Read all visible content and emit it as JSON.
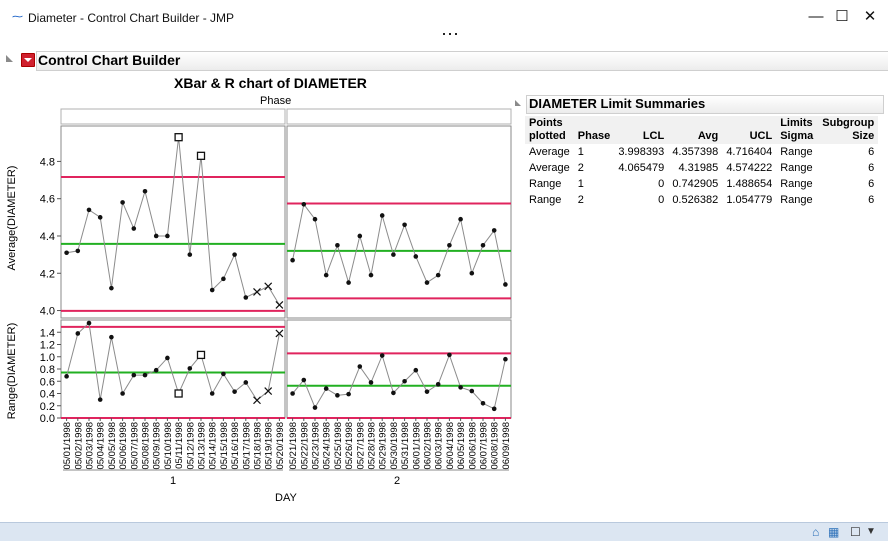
{
  "window": {
    "title": "Diameter - Control Chart Builder - JMP",
    "app_icon": "jmp-icon",
    "minimize": "—",
    "maximize": "☐",
    "close": "✕"
  },
  "report": {
    "header": "Control Chart Builder",
    "chart_title": "XBar & R chart of DIAMETER",
    "phase_label": "Phase",
    "phase_headers": [
      "1",
      "2"
    ],
    "xbar_ylabel": "Average(DIAMETER)",
    "r_ylabel": "Range(DIAMETER)",
    "x_group_labels": [
      "1",
      "2"
    ],
    "xlabel": "DAY"
  },
  "summary": {
    "title": "DIAMETER Limit Summaries",
    "columns": [
      "Points plotted",
      "Phase",
      "LCL",
      "Avg",
      "UCL",
      "Limits Sigma",
      "Subgroup Size"
    ],
    "rows": [
      [
        "Average",
        "1",
        "3.998393",
        "4.357398",
        "4.716404",
        "Range",
        "6"
      ],
      [
        "Average",
        "2",
        "4.065479",
        "4.31985",
        "4.574222",
        "Range",
        "6"
      ],
      [
        "Range",
        "1",
        "0",
        "0.742905",
        "1.488654",
        "Range",
        "6"
      ],
      [
        "Range",
        "2",
        "0",
        "0.526382",
        "1.054779",
        "Range",
        "6"
      ]
    ]
  },
  "chart_data": [
    {
      "type": "line",
      "title": "XBar & R chart of DIAMETER",
      "ylabel": "Average(DIAMETER)",
      "ylim": [
        3.96,
        4.99
      ],
      "yticks": [
        "4.0",
        "4.2",
        "4.4",
        "4.6",
        "4.8"
      ],
      "x": [
        "05/01/1998",
        "05/02/1998",
        "05/03/1998",
        "05/04/1998",
        "05/05/1998",
        "05/06/1998",
        "05/07/1998",
        "05/08/1998",
        "05/09/1998",
        "05/10/1998",
        "05/11/1998",
        "05/12/1998",
        "05/13/1998",
        "05/14/1998",
        "05/15/1998",
        "05/16/1998",
        "05/17/1998",
        "05/18/1998",
        "05/19/1998",
        "05/20/1998",
        "05/21/1998",
        "05/22/1998",
        "05/23/1998",
        "05/24/1998",
        "05/25/1998",
        "05/26/1998",
        "05/27/1998",
        "05/28/1998",
        "05/29/1998",
        "05/30/1998",
        "05/31/1998",
        "06/01/1998",
        "06/02/1998",
        "06/03/1998",
        "06/04/1998",
        "06/05/1998",
        "06/06/1998",
        "06/07/1998",
        "06/08/1998",
        "06/09/1998"
      ],
      "phases": [
        {
          "phase": "1",
          "values": [
            4.31,
            4.32,
            4.54,
            4.5,
            4.12,
            4.58,
            4.44,
            4.64,
            4.4,
            4.4,
            4.93,
            4.3,
            4.83,
            4.11,
            4.17,
            4.3,
            4.07,
            4.1,
            4.13,
            4.03
          ],
          "markers": [
            "dot",
            "dot",
            "dot",
            "dot",
            "dot",
            "dot",
            "dot",
            "dot",
            "dot",
            "dot",
            "square",
            "dot",
            "square",
            "dot",
            "dot",
            "dot",
            "dot",
            "x",
            "x",
            "x"
          ],
          "lcl": 3.998393,
          "avg": 4.357398,
          "ucl": 4.716404
        },
        {
          "phase": "2",
          "values": [
            4.27,
            4.57,
            4.49,
            4.19,
            4.35,
            4.15,
            4.4,
            4.19,
            4.51,
            4.3,
            4.46,
            4.29,
            4.15,
            4.19,
            4.35,
            4.49,
            4.2,
            4.35,
            4.43,
            4.14
          ],
          "markers": [
            "dot",
            "dot",
            "dot",
            "dot",
            "dot",
            "dot",
            "dot",
            "dot",
            "dot",
            "dot",
            "dot",
            "dot",
            "dot",
            "dot",
            "dot",
            "dot",
            "dot",
            "dot",
            "dot",
            "dot"
          ],
          "lcl": 4.065479,
          "avg": 4.31985,
          "ucl": 4.574222
        }
      ]
    },
    {
      "type": "line",
      "ylabel": "Range(DIAMETER)",
      "ylim": [
        0,
        1.6
      ],
      "yticks": [
        "0.0",
        "0.2",
        "0.4",
        "0.6",
        "0.8",
        "1.0",
        "1.2",
        "1.4"
      ],
      "phases": [
        {
          "phase": "1",
          "values": [
            0.68,
            1.38,
            1.55,
            0.3,
            1.32,
            0.4,
            0.7,
            0.7,
            0.78,
            0.98,
            0.4,
            0.81,
            1.03,
            0.4,
            0.72,
            0.43,
            0.58,
            0.29,
            0.44,
            1.38
          ],
          "markers": [
            "dot",
            "dot",
            "dot",
            "dot",
            "dot",
            "dot",
            "dot",
            "dot",
            "dot",
            "dot",
            "square",
            "dot",
            "square",
            "dot",
            "dot",
            "dot",
            "dot",
            "x",
            "x",
            "x"
          ],
          "lcl": 0,
          "avg": 0.742905,
          "ucl": 1.488654
        },
        {
          "phase": "2",
          "values": [
            0.4,
            0.62,
            0.17,
            0.48,
            0.37,
            0.39,
            0.84,
            0.58,
            1.02,
            0.41,
            0.6,
            0.78,
            0.43,
            0.55,
            1.03,
            0.5,
            0.44,
            0.24,
            0.15,
            0.96
          ],
          "markers": [
            "dot",
            "dot",
            "dot",
            "dot",
            "dot",
            "dot",
            "dot",
            "dot",
            "dot",
            "dot",
            "dot",
            "dot",
            "dot",
            "dot",
            "dot",
            "dot",
            "dot",
            "dot",
            "dot",
            "dot"
          ],
          "lcl": 0,
          "avg": 0.526382,
          "ucl": 1.054779
        }
      ]
    }
  ],
  "colors": {
    "limit": "#e0245e",
    "center": "#22b022",
    "line": "#8c8c8c",
    "point": "#111111"
  }
}
